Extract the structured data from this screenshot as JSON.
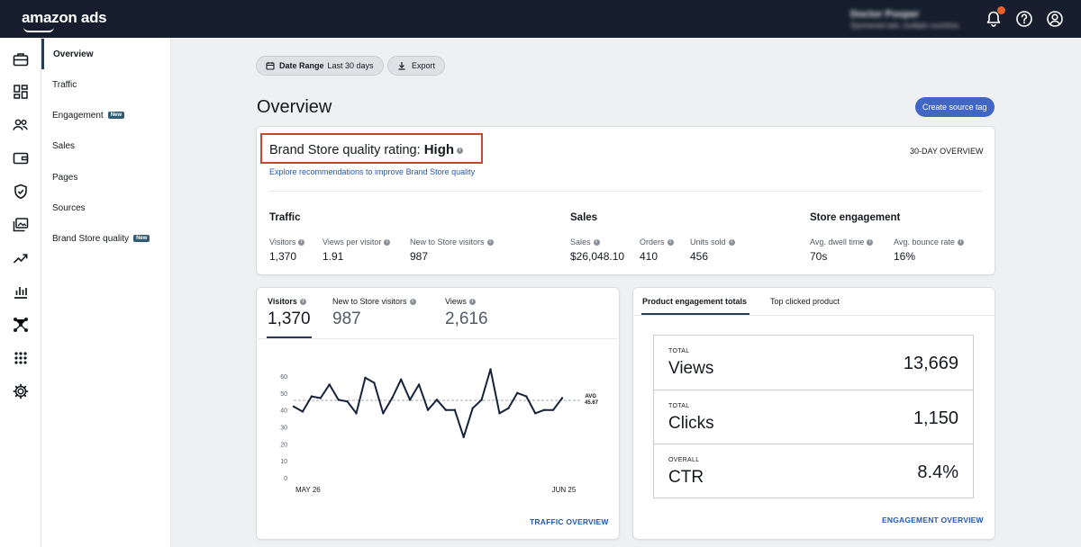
{
  "brand": {
    "logo_text": "amazon ads"
  },
  "account": {
    "name": "Doctor Pooper",
    "subtitle": "Sponsored ads, multiple countries"
  },
  "subnav": {
    "items": [
      {
        "label": "Overview",
        "active": true
      },
      {
        "label": "Traffic"
      },
      {
        "label": "Engagement",
        "badge": "New"
      },
      {
        "label": "Sales"
      },
      {
        "label": "Pages"
      },
      {
        "label": "Sources"
      },
      {
        "label": "Brand Store quality",
        "badge": "New"
      }
    ]
  },
  "toolbar": {
    "date_range_label": "Date Range",
    "date_range_value": "Last 30 days",
    "export_label": "Export"
  },
  "page": {
    "title": "Overview",
    "create_button": "Create source tag"
  },
  "quality": {
    "label": "Brand Store quality rating:",
    "value": "High",
    "link": "Explore recommendations to improve Brand Store quality",
    "period": "30-DAY OVERVIEW"
  },
  "summary": {
    "traffic": {
      "title": "Traffic",
      "metrics": [
        {
          "label": "Visitors",
          "value": "1,370"
        },
        {
          "label": "Views per visitor",
          "value": "1.91"
        },
        {
          "label": "New to Store visitors",
          "value": "987"
        }
      ]
    },
    "sales": {
      "title": "Sales",
      "metrics": [
        {
          "label": "Sales",
          "value": "$26,048.10"
        },
        {
          "label": "Orders",
          "value": "410"
        },
        {
          "label": "Units sold",
          "value": "456"
        }
      ]
    },
    "engagement": {
      "title": "Store engagement",
      "metrics": [
        {
          "label": "Avg. dwell time",
          "value": "70s"
        },
        {
          "label": "Avg. bounce rate",
          "value": "16%"
        }
      ]
    }
  },
  "traffic_card": {
    "tabs": [
      {
        "label": "Visitors",
        "value": "1,370",
        "active": true
      },
      {
        "label": "New to Store visitors",
        "value": "987"
      },
      {
        "label": "Views",
        "value": "2,616"
      }
    ],
    "footer_link": "TRAFFIC OVERVIEW"
  },
  "chart_data": {
    "type": "line",
    "x_start_label": "MAY 26",
    "x_end_label": "JUN 25",
    "ylim": [
      0,
      60
    ],
    "yticks": [
      "0",
      "10",
      "20",
      "30",
      "40",
      "50",
      "60"
    ],
    "avg_label": "AVG",
    "avg_value": 45.67,
    "avg_text": "45.67",
    "series": [
      {
        "values": [
          42,
          39,
          48,
          47,
          55,
          46,
          45,
          38,
          59,
          56,
          38,
          47,
          58,
          46,
          55,
          40,
          46,
          40,
          40,
          24,
          41,
          46,
          64,
          38,
          41,
          50,
          48,
          38,
          40,
          40,
          47
        ]
      }
    ],
    "line_color": "#16223a",
    "grid": false
  },
  "engagement_card": {
    "tabs": [
      {
        "label": "Product engagement totals",
        "active": true
      },
      {
        "label": "Top clicked product"
      }
    ],
    "totals": [
      {
        "caption": "TOTAL",
        "name": "Views",
        "value": "13,669"
      },
      {
        "caption": "TOTAL",
        "name": "Clicks",
        "value": "1,150"
      },
      {
        "caption": "OVERALL",
        "name": "CTR",
        "value": "8.4%"
      }
    ],
    "footer_link": "ENGAGEMENT OVERVIEW"
  },
  "icons": {
    "top": [
      "bell-icon",
      "help-icon",
      "account-icon"
    ],
    "rail": [
      "briefcase-icon",
      "dashboard-icon",
      "audience-icon",
      "wallet-icon",
      "shield-icon",
      "media-icon",
      "trend-icon",
      "bar-chart-icon",
      "network-icon",
      "apps-icon",
      "gear-icon"
    ]
  },
  "colors": {
    "topbar": "#161e2d",
    "accent": "#4166c4",
    "highlight_border": "#d0432d",
    "link": "#2457b5",
    "notification": "#e8612c"
  }
}
